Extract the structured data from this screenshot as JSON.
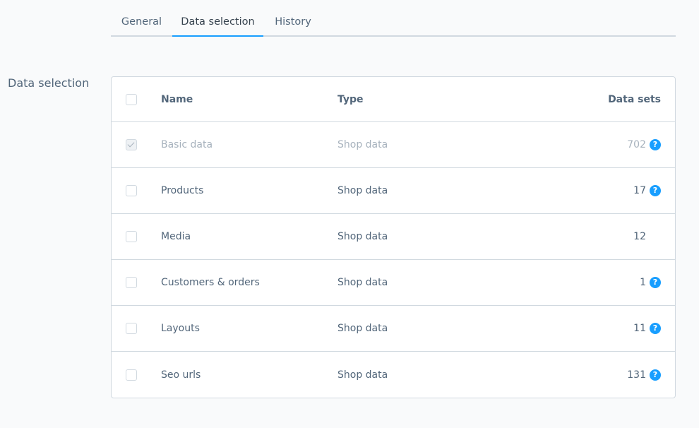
{
  "tabs": [
    {
      "label": "General",
      "active": false
    },
    {
      "label": "Data selection",
      "active": true
    },
    {
      "label": "History",
      "active": false
    }
  ],
  "section_label": "Data selection",
  "columns": {
    "name": "Name",
    "type": "Type",
    "data_sets": "Data sets"
  },
  "rows": [
    {
      "name": "Basic data",
      "type": "Shop data",
      "data_sets": "702",
      "checked": true,
      "disabled": true,
      "help": true
    },
    {
      "name": "Products",
      "type": "Shop data",
      "data_sets": "17",
      "checked": false,
      "disabled": false,
      "help": true
    },
    {
      "name": "Media",
      "type": "Shop data",
      "data_sets": "12",
      "checked": false,
      "disabled": false,
      "help": false
    },
    {
      "name": "Customers & orders",
      "type": "Shop data",
      "data_sets": "1",
      "checked": false,
      "disabled": false,
      "help": true
    },
    {
      "name": "Layouts",
      "type": "Shop data",
      "data_sets": "11",
      "checked": false,
      "disabled": false,
      "help": true
    },
    {
      "name": "Seo urls",
      "type": "Shop data",
      "data_sets": "131",
      "checked": false,
      "disabled": false,
      "help": true
    }
  ],
  "help_icon_glyph": "?",
  "colors": {
    "accent": "#189eff",
    "text": "#52667a",
    "disabled_text": "#a7b2bd",
    "border": "#d1d9e0"
  }
}
